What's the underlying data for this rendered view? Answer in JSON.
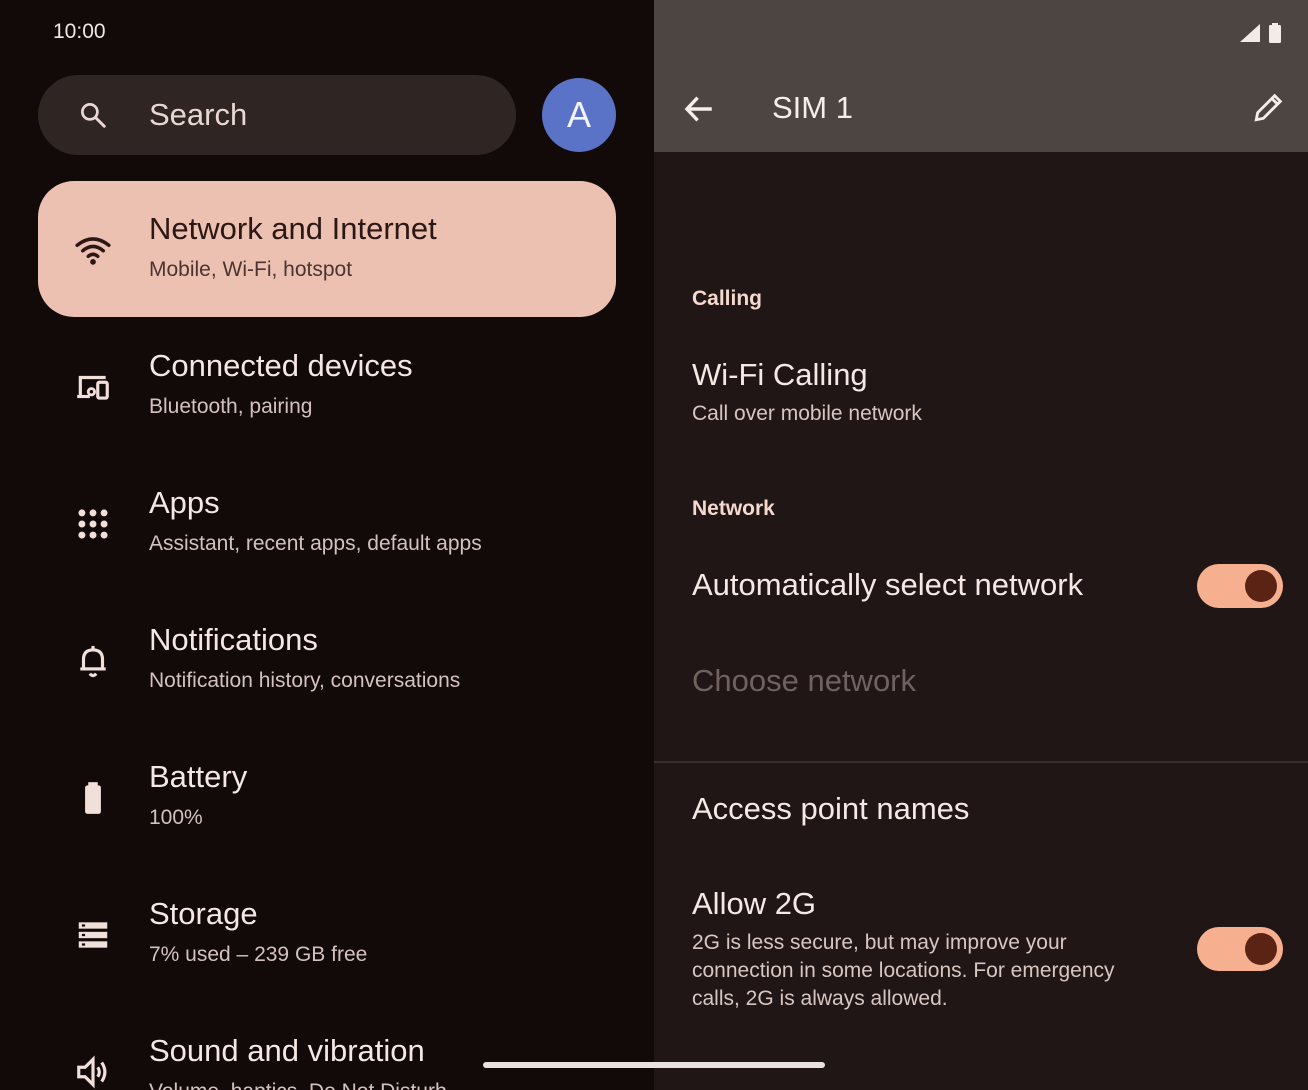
{
  "status": {
    "time": "10:00"
  },
  "search": {
    "placeholder": "Search",
    "icon": "search-icon"
  },
  "account": {
    "initial": "A",
    "color": "#5b73c6"
  },
  "left_items": [
    {
      "title": "Network and Internet",
      "subtitle": "Mobile, Wi-Fi, hotspot",
      "icon": "wifi-icon",
      "selected": true
    },
    {
      "title": "Connected devices",
      "subtitle": "Bluetooth, pairing",
      "icon": "devices-icon"
    },
    {
      "title": "Apps",
      "subtitle": "Assistant, recent apps, default apps",
      "icon": "apps-grid-icon"
    },
    {
      "title": "Notifications",
      "subtitle": "Notification history, conversations",
      "icon": "bell-icon"
    },
    {
      "title": "Battery",
      "subtitle": "100%",
      "icon": "battery-icon"
    },
    {
      "title": "Storage",
      "subtitle": "7% used – 239 GB free",
      "icon": "storage-icon"
    },
    {
      "title": "Sound and vibration",
      "subtitle": "Volume, haptics, Do Not Disturb",
      "icon": "speaker-icon"
    }
  ],
  "detail": {
    "title": "SIM 1",
    "back_icon": "arrow-back-icon",
    "edit_icon": "edit-pencil-icon",
    "calling_header": "Calling",
    "wifi_calling": {
      "title": "Wi-Fi Calling",
      "subtitle": "Call over mobile network"
    },
    "network_header": "Network",
    "auto_select": {
      "title": "Automatically select network",
      "enabled": true
    },
    "choose_network": "Choose network",
    "apn": "Access point names",
    "allow_2g": {
      "title": "Allow 2G",
      "subtitle": "2G is less secure, but may improve your connection in some locations. For emergency calls, 2G is always allowed.",
      "enabled": true
    }
  },
  "colors": {
    "selected_bg": "#ecc1b2",
    "toggle_on": "#f7b08f",
    "appbar_bg": "#4d4542"
  }
}
